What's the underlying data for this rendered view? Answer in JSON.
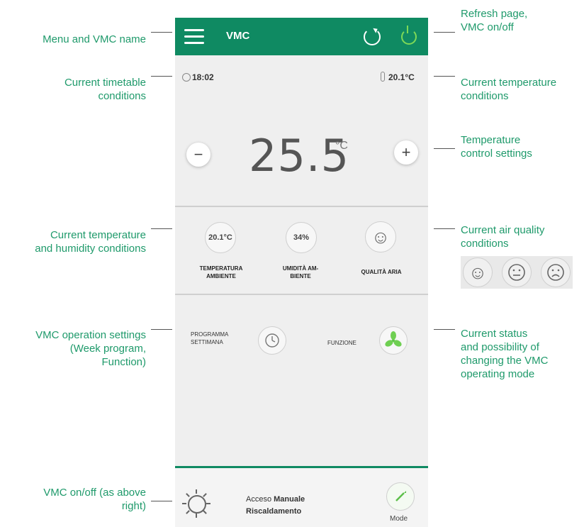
{
  "annotations": {
    "menu": [
      "Menu and VMC name"
    ],
    "refresh": [
      "Refresh page,",
      "VMC on/off"
    ],
    "timetable": [
      "Current timetable",
      "conditions"
    ],
    "temperature": [
      "Current temperature",
      "conditions"
    ],
    "temp_control": [
      "Temperature",
      "control settings"
    ],
    "temp_humidity": [
      "Current temperature",
      "and humidity conditions"
    ],
    "air_quality": [
      "Current air quality",
      "conditions"
    ],
    "operation": [
      "VMC operation settings",
      "(Week program,",
      "Function)"
    ],
    "status": [
      "Current status",
      "and possibility of",
      "changing the VMC",
      "operating mode"
    ],
    "onoff": [
      "VMC on/off (as above",
      "right)"
    ]
  },
  "app": {
    "title": "VMC",
    "time": "18:02",
    "current_temp": "20.1°C",
    "setpoint": "25.5",
    "setpoint_unit": "°C",
    "minus": "−",
    "plus": "+",
    "ambient_temp": "20.1°C",
    "ambient_temp_label": [
      "TEMPERATURA",
      "AMBIENTE"
    ],
    "humidity": "34%",
    "humidity_label": [
      "UMIDITÀ AM-",
      "BIENTE"
    ],
    "air_quality_label": "QUALITÀ ARIA",
    "program_label": [
      "PROGRAMMA",
      "SETTIMANA"
    ],
    "function_label": "FUNZIONE",
    "status_prefix": "Acceso",
    "status_mode": "Manuale",
    "status_season": "Riscaldamento",
    "mode_label": "Mode",
    "smiley": "☺"
  },
  "colors": {
    "brand_green": "#0f8a62",
    "annotation_green": "#1f9a6b",
    "power_green": "#7ed957"
  },
  "icons": [
    "menu-icon",
    "refresh-icon",
    "power-icon",
    "clock-icon",
    "thermometer-icon",
    "smiley-icon",
    "fan-icon",
    "sun-icon",
    "pen-icon"
  ]
}
